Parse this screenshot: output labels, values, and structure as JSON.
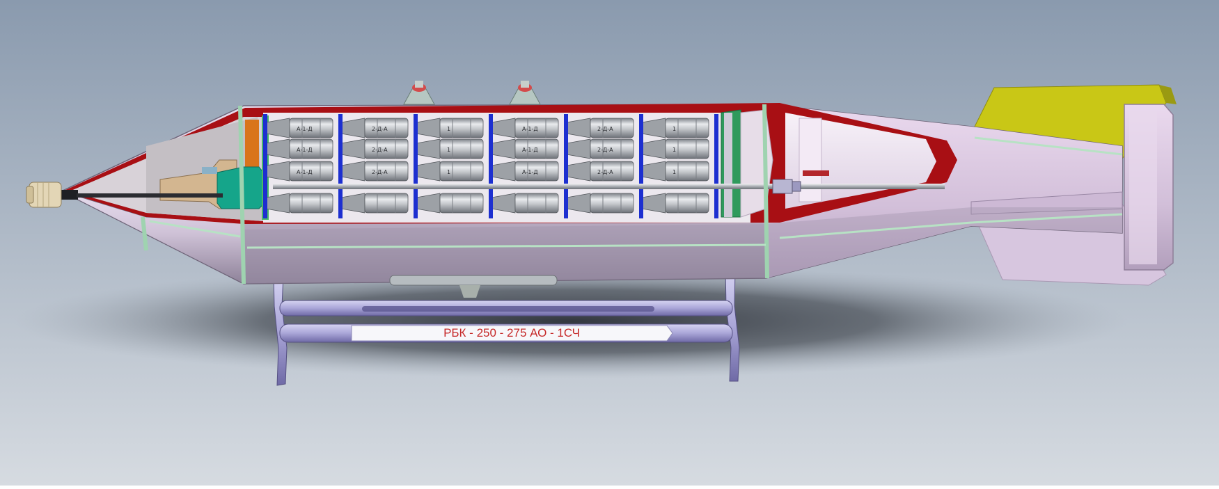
{
  "render": {
    "stand_label": "РБК - 250 - 275  АО - 1СЧ",
    "submunition_markings": [
      "А-1-Д",
      "2-Д-А",
      "1"
    ],
    "colors": {
      "background_top": "#8a9aae",
      "background_bottom": "#d6dbe1",
      "casing": "#cfc2d7",
      "casing_shadow": "#8e8299",
      "cut_section": "#a80f14",
      "band": "#9fd3b0",
      "fins": "#c9c716",
      "stand": "#aaa6d8",
      "stand_label_text": "#c62828",
      "submunition": "#b9bcc0",
      "retainer_rings": "#1d2fd0",
      "nose_fuze": "#e3d6b6",
      "green_bulkhead": "#2f9a5c",
      "teal_adapter": "#15a58a"
    }
  }
}
